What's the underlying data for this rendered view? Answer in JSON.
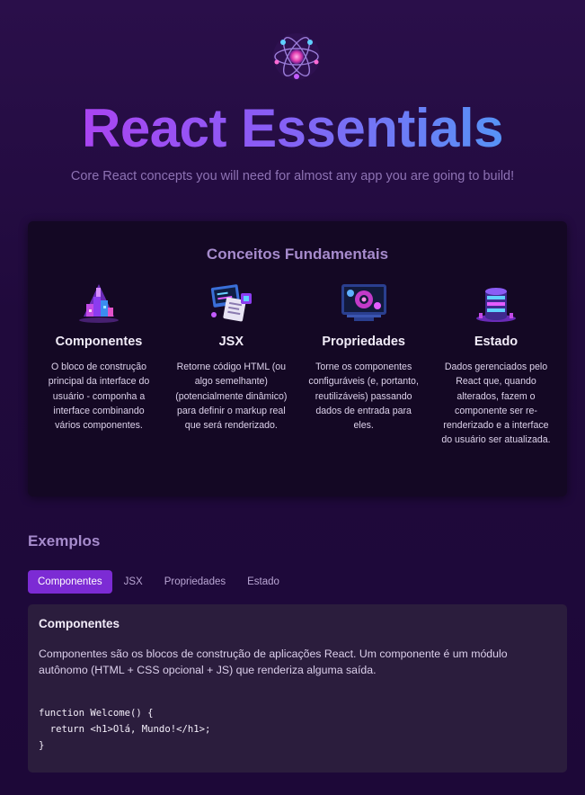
{
  "header": {
    "logo_icon": "atom-logo-icon",
    "title": "React Essentials",
    "tagline": "Core React concepts you will need for almost any app you are going to build!"
  },
  "core_concepts": {
    "title": "Conceitos Fundamentais",
    "items": [
      {
        "icon": "components-icon",
        "title": "Componentes",
        "description": "O bloco de construção principal da interface do usuário - componha a interface combinando vários componentes."
      },
      {
        "icon": "jsx-icon",
        "title": "JSX",
        "description": "Retorne código HTML (ou algo semelhante) (potencialmente dinâmico) para definir o markup real que será renderizado."
      },
      {
        "icon": "props-icon",
        "title": "Propriedades",
        "description": "Torne os componentes configuráveis (e, portanto, reutilizáveis) passando dados de entrada para eles."
      },
      {
        "icon": "state-icon",
        "title": "Estado",
        "description": "Dados gerenciados pelo React que, quando alterados, fazem o componente ser re-renderizado e a interface do usuário ser atualizada."
      }
    ]
  },
  "examples": {
    "title": "Exemplos",
    "tabs": [
      {
        "label": "Componentes",
        "active": true
      },
      {
        "label": "JSX",
        "active": false
      },
      {
        "label": "Propriedades",
        "active": false
      },
      {
        "label": "Estado",
        "active": false
      }
    ],
    "content": {
      "title": "Componentes",
      "description": "Componentes são os blocos de construção de aplicações React. Um componente é um módulo autônomo (HTML + CSS opcional + JS) que renderiza alguma saída.",
      "code": "function Welcome() {\n  return <h1>Olá, Mundo!</h1>;\n}"
    }
  },
  "colors": {
    "accent": "#7c2bd4",
    "title_gradient_start": "#b83af0",
    "title_gradient_end": "#45a6f6",
    "section_title": "#a68bcc"
  }
}
